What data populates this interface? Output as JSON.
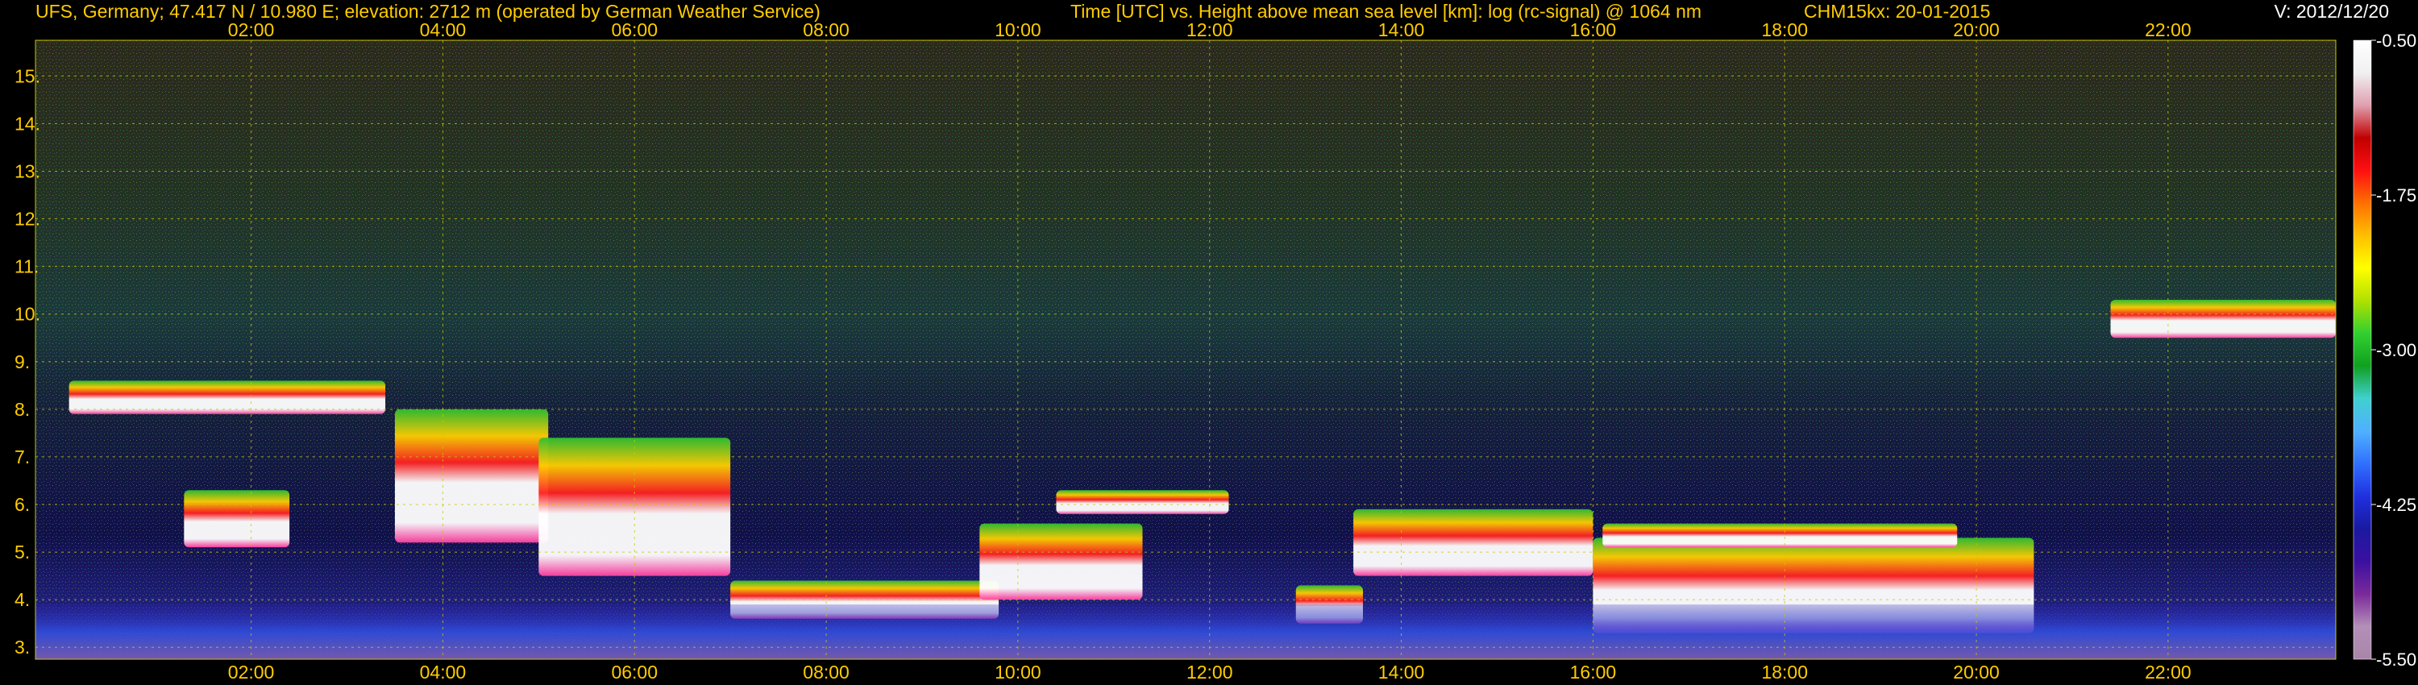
{
  "header": {
    "title_left": "UFS, Germany; 47.417 N / 10.980 E; elevation: 2712 m  (operated by German Weather Service)",
    "title_center": "Time [UTC] vs. Height above mean sea level [km]: log (rc-signal) @ 1064 nm",
    "instrument": "CHM15kx: 20-01-2015",
    "version": "V: 2012/12/20"
  },
  "colors": {
    "text": "#ffcc00",
    "grid": "#c8c800",
    "background": "#000000",
    "colorbar_text": "#ffffff"
  },
  "chart_data": {
    "type": "heatmap",
    "title": "Time [UTC] vs. Height above mean sea level [km]: log (rc-signal) @ 1064 nm",
    "xlabel": "Time [UTC]",
    "ylabel": "Height above mean sea level [km]",
    "x_ticks": [
      "02:00",
      "04:00",
      "06:00",
      "08:00",
      "10:00",
      "12:00",
      "14:00",
      "16:00",
      "18:00",
      "20:00",
      "22:00"
    ],
    "x_tick_hours": [
      2,
      4,
      6,
      8,
      10,
      12,
      14,
      16,
      18,
      20,
      22
    ],
    "xlim_hours": [
      -0.25,
      23.75
    ],
    "y_ticks": [
      "3.",
      "4.",
      "5.",
      "6.",
      "7.",
      "8.",
      "9.",
      "10.",
      "11.",
      "12.",
      "13.",
      "14.",
      "15."
    ],
    "y_tick_values": [
      3,
      4,
      5,
      6,
      7,
      8,
      9,
      10,
      11,
      12,
      13,
      14,
      15
    ],
    "ylim_km": [
      2.75,
      15.75
    ],
    "grid": true,
    "colorbar": {
      "ticks": [
        "-0.50",
        "-1.75",
        "-3.00",
        "-4.25",
        "-5.50"
      ],
      "tick_values": [
        -0.5,
        -1.75,
        -3.0,
        -4.25,
        -5.5
      ],
      "range": [
        -5.5,
        -0.5
      ],
      "colors": [
        "#a886a8",
        "#b48fb8",
        "#7a2a9a",
        "#3a10a0",
        "#1a1aa0",
        "#2030e0",
        "#3070ff",
        "#50b0ff",
        "#40d0d0",
        "#10a020",
        "#30d030",
        "#b0e000",
        "#ffff00",
        "#ffc000",
        "#ff7000",
        "#ff1010",
        "#c00000",
        "#e0a0b0",
        "#f0f0f0",
        "#ffffff"
      ]
    },
    "features": [
      {
        "type": "cloud",
        "t_start": 0.1,
        "t_end": 3.4,
        "h_bottom": 7.9,
        "h_top": 8.6
      },
      {
        "type": "cloud",
        "t_start": 1.3,
        "t_end": 2.4,
        "h_bottom": 5.1,
        "h_top": 6.3
      },
      {
        "type": "cloud",
        "t_start": 3.5,
        "t_end": 5.1,
        "h_bottom": 5.2,
        "h_top": 8.0
      },
      {
        "type": "cloud",
        "t_start": 5.0,
        "t_end": 7.0,
        "h_bottom": 4.5,
        "h_top": 7.4
      },
      {
        "type": "cloud",
        "t_start": 7.0,
        "t_end": 9.8,
        "h_bottom": 3.6,
        "h_top": 4.4
      },
      {
        "type": "cloud",
        "t_start": 9.6,
        "t_end": 11.3,
        "h_bottom": 4.0,
        "h_top": 5.6
      },
      {
        "type": "cloud",
        "t_start": 10.4,
        "t_end": 12.2,
        "h_bottom": 5.8,
        "h_top": 6.3
      },
      {
        "type": "cloud",
        "t_start": 12.9,
        "t_end": 13.6,
        "h_bottom": 3.5,
        "h_top": 4.3
      },
      {
        "type": "cloud",
        "t_start": 13.5,
        "t_end": 16.0,
        "h_bottom": 4.5,
        "h_top": 5.9
      },
      {
        "type": "cloud",
        "t_start": 16.0,
        "t_end": 20.6,
        "h_bottom": 3.3,
        "h_top": 5.3
      },
      {
        "type": "cloud",
        "t_start": 16.1,
        "t_end": 19.8,
        "h_bottom": 5.1,
        "h_top": 5.6
      },
      {
        "type": "cloud",
        "t_start": 21.4,
        "t_end": 23.8,
        "h_bottom": 9.5,
        "h_top": 10.3
      },
      {
        "type": "boundary_layer",
        "t_start": -0.25,
        "t_end": 23.75,
        "h_bottom": 2.75,
        "h_top": 3.9
      }
    ]
  }
}
